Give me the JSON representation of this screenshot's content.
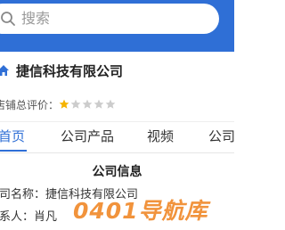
{
  "search": {
    "placeholder": "搜索",
    "icon": "search-icon"
  },
  "shop": {
    "icon": "home-icon",
    "name": "捷信科技有限公司"
  },
  "rating": {
    "label": "店铺总评价：",
    "stars_filled": 1,
    "stars_total": 5,
    "star_color_filled": "#f5b301",
    "star_color_empty": "#cccccc"
  },
  "tabs": [
    {
      "label": "首页",
      "active": true
    },
    {
      "label": "公司产品",
      "active": false
    },
    {
      "label": "视频",
      "active": false
    },
    {
      "label": "公司",
      "active": false
    }
  ],
  "company_info": {
    "title": "公司信息",
    "name_line": "公司名称：捷信科技有限公司",
    "contact_line": "联系人：肖凡"
  },
  "watermark": {
    "text": "0401导航库"
  },
  "colors": {
    "brand": "#2f6fd6",
    "watermark": "#f08a2c"
  }
}
